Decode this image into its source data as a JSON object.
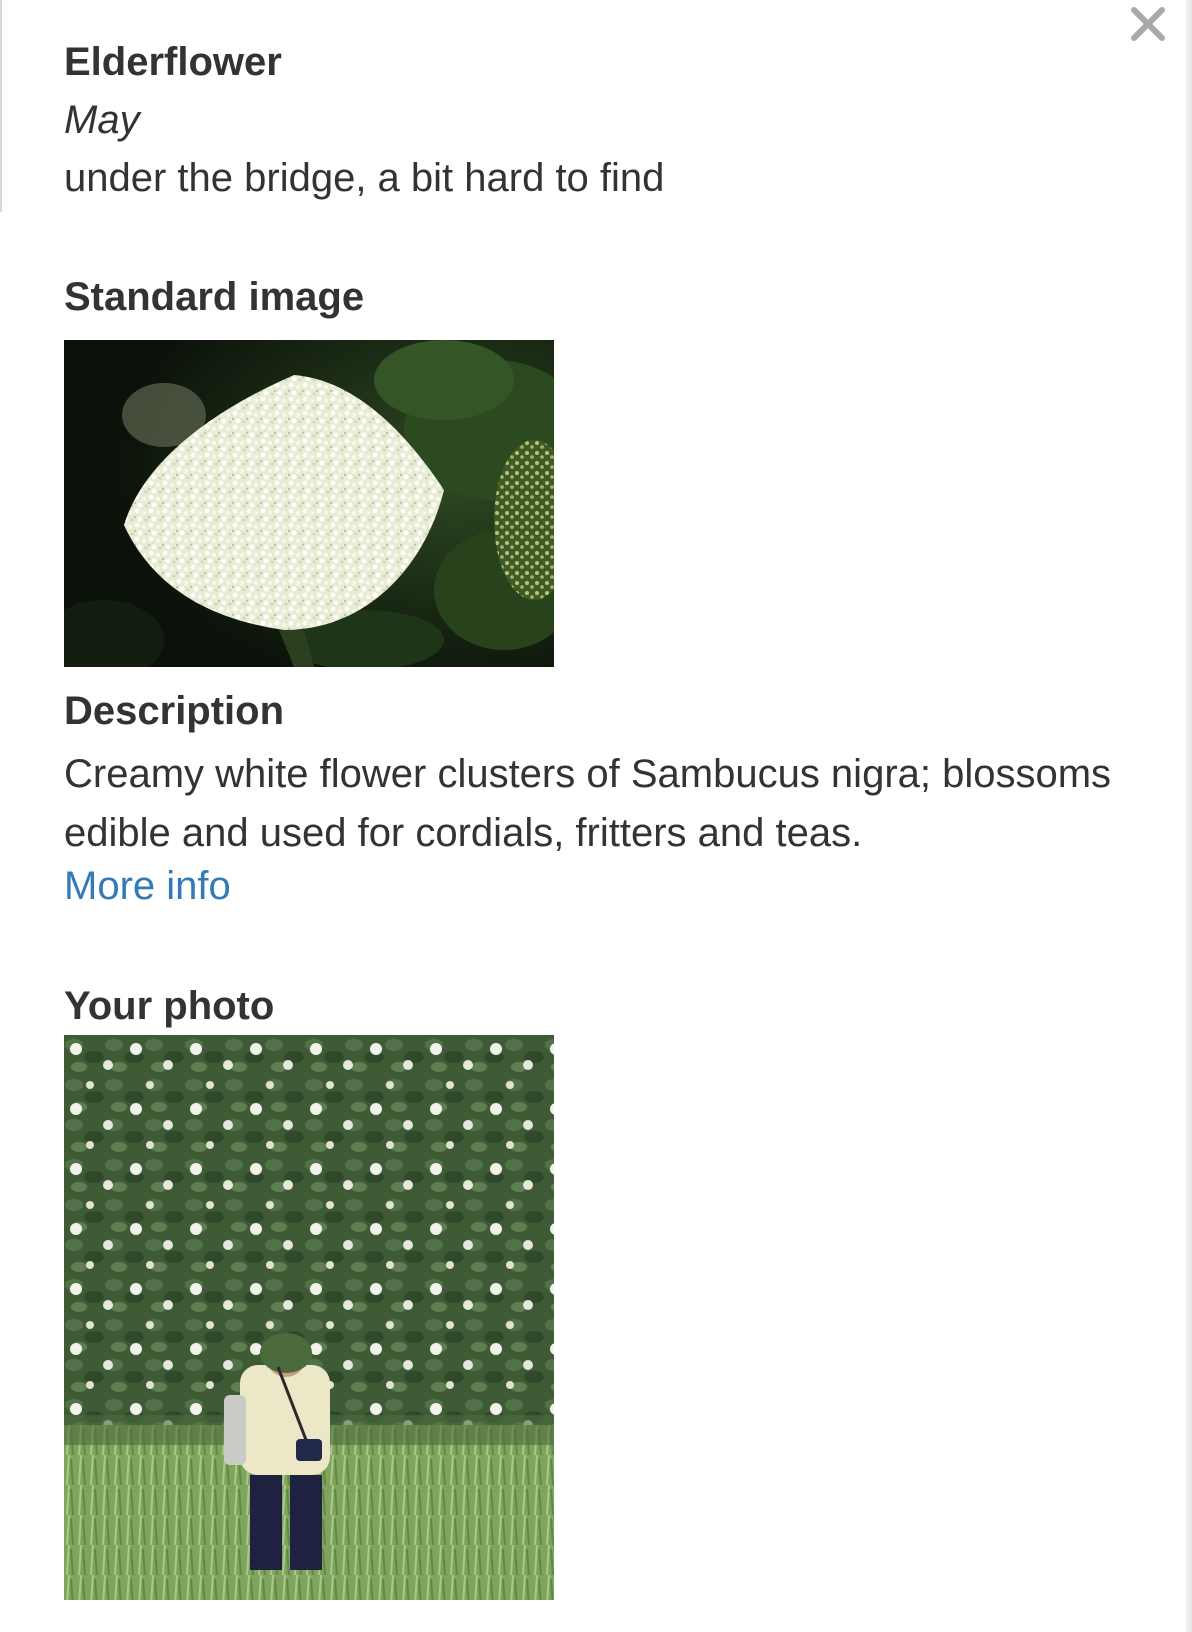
{
  "modal": {
    "close_icon": "close-icon",
    "title": "Elderflower",
    "season": "May",
    "location_note": "under the bridge, a bit hard to find"
  },
  "standard_image": {
    "heading": "Standard image",
    "content": "elderflower-blossom-photo"
  },
  "description": {
    "heading": "Description",
    "text": "Creamy white flower clusters of Sambucus nigra; blossoms edible and used for cordials, fritters and teas.",
    "link_label": "More info",
    "link_color": "#337ab7"
  },
  "your_photo": {
    "heading": "Your photo",
    "content": "person-foraging-at-elder-bush-photo"
  },
  "colors": {
    "text": "#333333",
    "link": "#337ab7",
    "background": "#ffffff"
  }
}
